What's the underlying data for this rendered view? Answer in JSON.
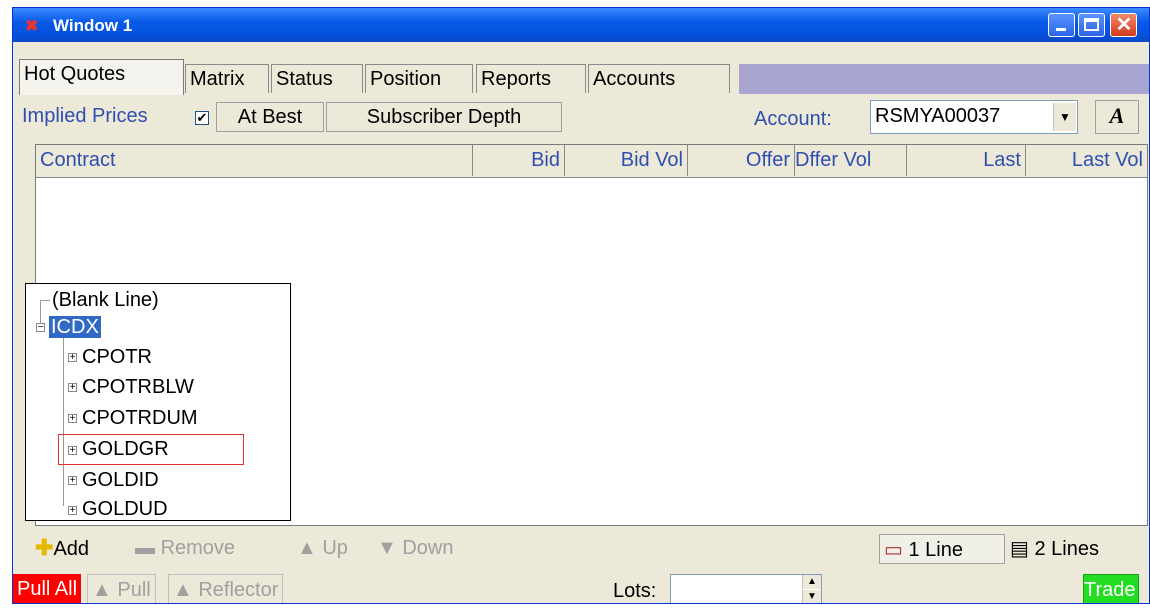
{
  "window": {
    "title": "Window 1",
    "icon": "cross-app-icon",
    "controls": [
      "minimize-icon",
      "maximize-icon",
      "close-icon"
    ]
  },
  "tabs": [
    {
      "label": "Hot Quotes",
      "active": true
    },
    {
      "label": "Matrix",
      "active": false
    },
    {
      "label": "Status",
      "active": false
    },
    {
      "label": "Position",
      "active": false
    },
    {
      "label": "Reports",
      "active": false
    },
    {
      "label": "Accounts",
      "active": false
    }
  ],
  "toolbar": {
    "implied_prices_label": "Implied Prices",
    "implied_prices_checked": true,
    "at_best_label": "At Best",
    "subscriber_depth_label": "Subscriber Depth",
    "account_label": "Account:",
    "account_value": "RSMYA00037",
    "font_button_label": "A"
  },
  "grid": {
    "columns": [
      "Contract",
      "Bid",
      "Bid Vol",
      "Offer",
      "Dffer Vol",
      "Last",
      "Last Vol"
    ],
    "rows": []
  },
  "tree": {
    "items": [
      {
        "label": "(Blank Line)",
        "level": 0,
        "expander": "none"
      },
      {
        "label": "ICDX",
        "level": 0,
        "expander": "minus",
        "selected": true
      },
      {
        "label": "CPOTR",
        "level": 1,
        "expander": "plus"
      },
      {
        "label": "CPOTRBLW",
        "level": 1,
        "expander": "plus"
      },
      {
        "label": "CPOTRDUM",
        "level": 1,
        "expander": "plus"
      },
      {
        "label": "GOLDGR",
        "level": 1,
        "expander": "plus",
        "highlighted": true
      },
      {
        "label": "GOLDID",
        "level": 1,
        "expander": "plus"
      },
      {
        "label": "GOLDUD",
        "level": 1,
        "expander": "plus"
      }
    ]
  },
  "bottombar": {
    "add_label": "Add",
    "remove_label": "Remove",
    "up_label": "Up",
    "down_label": "Down",
    "one_line_label": "1 Line",
    "two_lines_label": "2 Lines"
  },
  "footer": {
    "pull_all_label": "Pull All",
    "pull_label": "Pull",
    "reflector_label": "Reflector",
    "lots_label": "Lots:",
    "lots_value": "",
    "trade_label": "Trade"
  },
  "colors": {
    "titlebar": "#0a5ae8",
    "pull_all": "#ff0000",
    "trade": "#22dd22",
    "link_text": "#2f4fb0",
    "selection": "#316ac5",
    "highlight_box": "#e03030"
  }
}
